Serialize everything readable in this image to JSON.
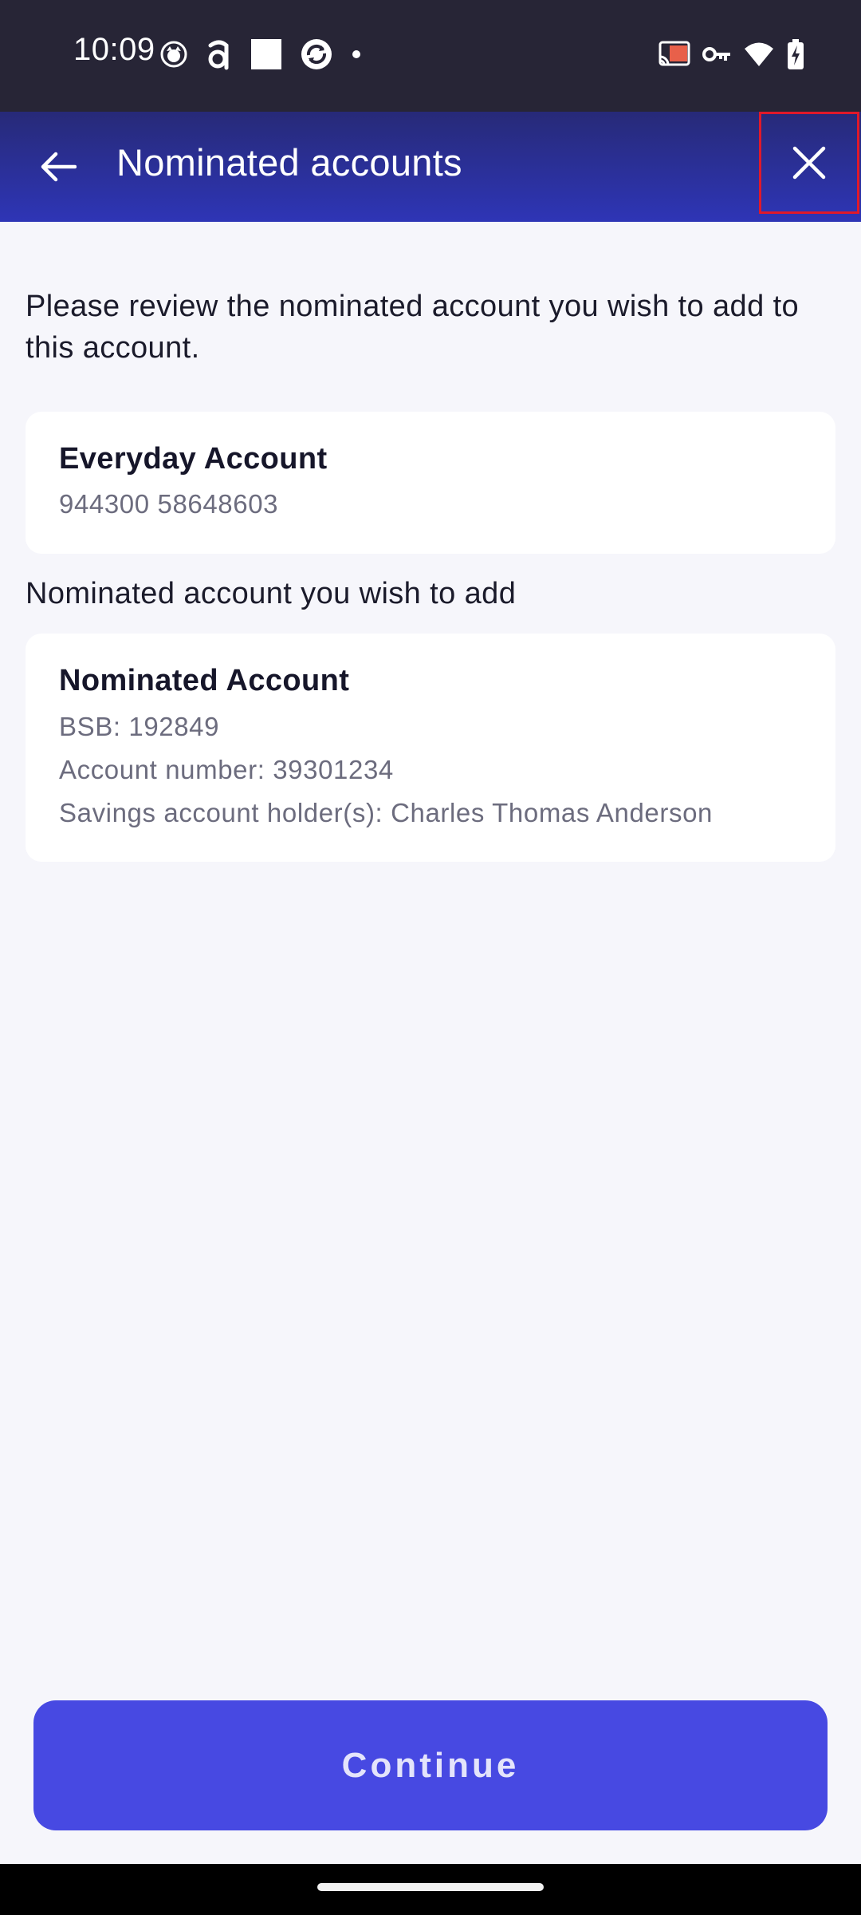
{
  "status_bar": {
    "time": "10:09",
    "left_icons": [
      "cat-face-icon",
      "a-logo-icon",
      "white-square-icon",
      "circular-arrows-icon",
      "dot-icon"
    ],
    "right_icons": [
      "cast-icon",
      "key-icon",
      "wifi-icon",
      "battery-charging-icon"
    ]
  },
  "app_bar": {
    "title": "Nominated accounts",
    "back_icon": "arrow-left-icon",
    "close_icon": "close-icon"
  },
  "intro": "Please review the nominated account you wish to add to this account.",
  "from_account": {
    "name": "Everyday Account",
    "number": "944300 58648603"
  },
  "section_label": "Nominated account you wish to add",
  "nominated_account": {
    "name": "Nominated Account",
    "bsb": "BSB: 192849",
    "account_number": "Account number: 39301234",
    "holders": "Savings account holder(s): Charles Thomas Anderson"
  },
  "continue_label": "Continue",
  "colors": {
    "app_bar_start": "#272a78",
    "app_bar_end": "#2e35b6",
    "primary_button": "#4749e2",
    "highlight_border": "#e0192a",
    "background": "#f6f6fb"
  }
}
